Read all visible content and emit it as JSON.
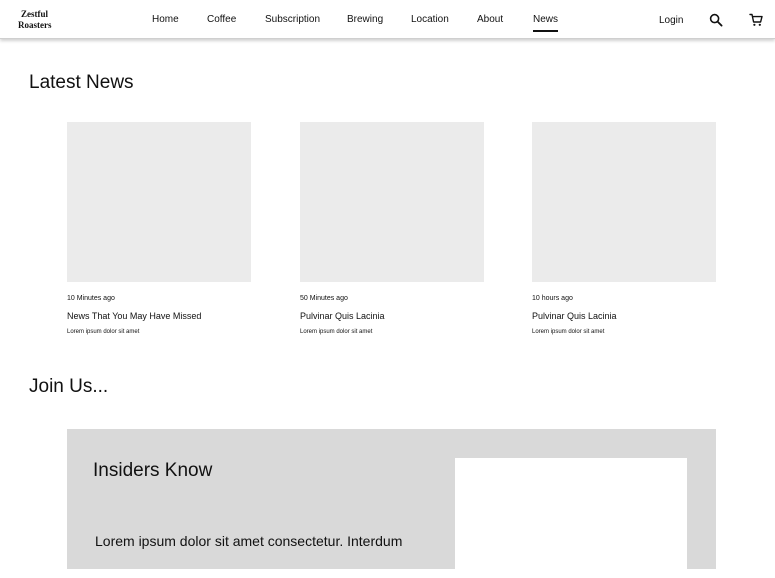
{
  "brand": {
    "line1": "Zestful",
    "line2": "Roasters"
  },
  "nav": {
    "links": [
      {
        "label": "Home"
      },
      {
        "label": "Coffee"
      },
      {
        "label": "Subscription"
      },
      {
        "label": "Brewing"
      },
      {
        "label": "Location"
      },
      {
        "label": "About"
      },
      {
        "label": "News",
        "active": true
      }
    ],
    "login_label": "Login",
    "icons": [
      "search-icon",
      "cart-icon"
    ]
  },
  "news": {
    "heading": "Latest News",
    "cards": [
      {
        "time": "10 Minutes ago",
        "title": "News That You May Have Missed",
        "description": "Lorem ipsum dolor sit amet"
      },
      {
        "time": "50 Minutes ago",
        "title": "Pulvinar Quis Lacinia",
        "description": "Lorem ipsum dolor sit amet"
      },
      {
        "time": "10 hours ago",
        "title": "Pulvinar Quis Lacinia",
        "description": "Lorem ipsum dolor sit amet"
      }
    ]
  },
  "join": {
    "heading": "Join Us...",
    "panel_title": "Insiders Know",
    "panel_text": "Lorem ipsum dolor sit amet consectetur. Interdum"
  },
  "colors": {
    "placeholder_image": "#ebebeb",
    "panel_background": "#d9d9d9",
    "text": "#111111"
  }
}
